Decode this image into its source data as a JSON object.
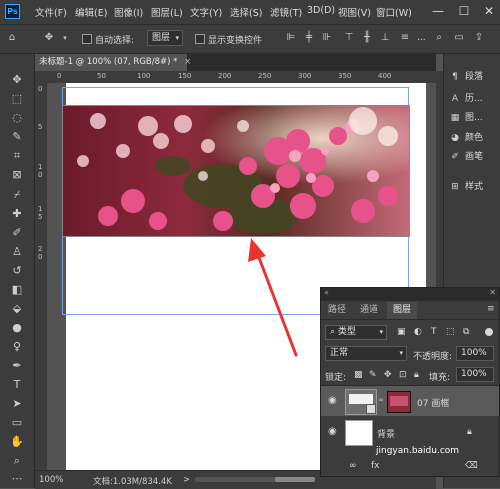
{
  "app": {
    "logo": "Ps"
  },
  "menu": [
    "文件(F)",
    "编辑(E)",
    "图像(I)",
    "图层(L)",
    "文字(Y)",
    "选择(S)",
    "滤镜(T)",
    "3D(D)",
    "视图(V)",
    "窗口(W)"
  ],
  "window_controls": {
    "minimize": "—",
    "maximize": "☐",
    "close": "✕"
  },
  "options": {
    "auto_select_label": "自动选择:",
    "auto_select_value": "图层",
    "show_transform_label": "显示变换控件",
    "more": "..."
  },
  "document": {
    "tab_title": "未标题-1 @ 100% (07, RGB/8#) *",
    "close": "×",
    "ruler_h": [
      "0",
      "50",
      "100",
      "150",
      "200",
      "250",
      "300",
      "350",
      "400"
    ],
    "ruler_v": [
      "0",
      "5",
      "1",
      "0",
      "1",
      "5",
      "2",
      "0"
    ]
  },
  "status": {
    "zoom": "100%",
    "doc_info": "文档:1.03M/834.4K",
    "arrow": ">"
  },
  "right_dock": {
    "items": [
      {
        "icon": "paragraph-icon",
        "label": "段落"
      },
      {
        "icon": "type-icon",
        "label": "历..."
      },
      {
        "icon": "grid-icon",
        "label": "图..."
      },
      {
        "icon": "palette-icon",
        "label": "颜色"
      },
      {
        "icon": "brush-icon",
        "label": "画笔"
      },
      {
        "icon": "style-icon",
        "label": "样式"
      }
    ]
  },
  "layers_panel": {
    "tabs": [
      "路径",
      "通道",
      "图层"
    ],
    "active_tab": "图层",
    "filter_label": "类型",
    "blend_mode": "正常",
    "opacity_label": "不透明度:",
    "opacity_value": "100%",
    "lock_label": "锁定:",
    "fill_label": "填充:",
    "fill_value": "100%",
    "layers": [
      {
        "name": "07 画框",
        "visible": true,
        "selected": true
      },
      {
        "name": "背景",
        "visible": true,
        "selected": false
      }
    ],
    "bottom_text": "fx"
  },
  "watermark": "jingyan.baidu.com",
  "colors": {
    "accent": "#31a8ff",
    "arrow": "#e8352f",
    "guide": "#7da0e6"
  }
}
